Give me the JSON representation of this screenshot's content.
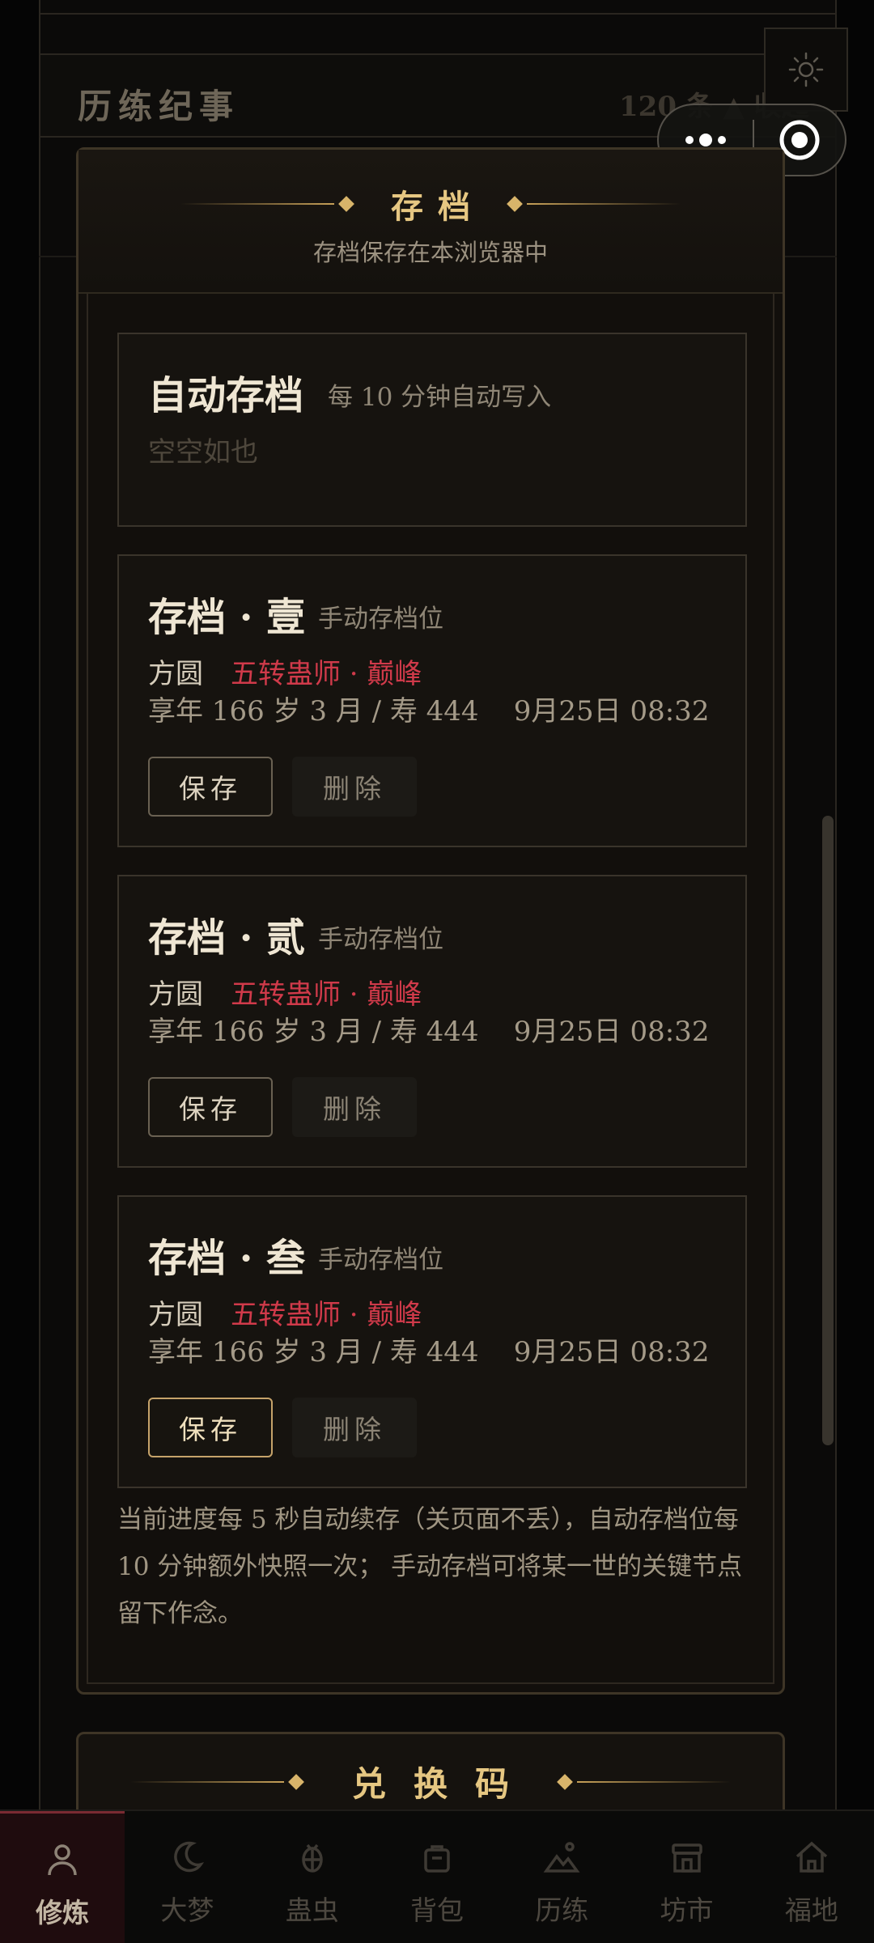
{
  "background": {
    "section_title": "历练纪事",
    "count_text": "120 条 ▲ 收起"
  },
  "modal": {
    "title": "存档",
    "subtitle": "存档保存在本浏览器中",
    "auto_slot": {
      "title": "自动存档",
      "tag": "每 10 分钟自动写入",
      "empty_text": "空空如也"
    },
    "slots": [
      {
        "title": "存档 · 壹",
        "tag": "手动存档位",
        "name": "方圆",
        "realm": "五转蛊师 · 巅峰",
        "age": "享年 166 岁 3 月 / 寿 444    9月25日 08:32",
        "save_label": "保存",
        "delete_label": "删除"
      },
      {
        "title": "存档 · 贰",
        "tag": "手动存档位",
        "name": "方圆",
        "realm": "五转蛊师 · 巅峰",
        "age": "享年 166 岁 3 月 / 寿 444    9月25日 08:32",
        "save_label": "保存",
        "delete_label": "删除"
      },
      {
        "title": "存档 · 叁",
        "tag": "手动存档位",
        "name": "方圆",
        "realm": "五转蛊师 · 巅峰",
        "age": "享年 166 岁 3 月 / 寿 444    9月25日 08:32",
        "save_label": "保存",
        "delete_label": "删除"
      }
    ],
    "note": "当前进度每 5 秒自动续存（关页面不丢），自动存档位每 10 分钟额外快照一次； 手动存档可将某一世的关键节点留下作念。"
  },
  "next_modal": {
    "title": "兑换码"
  },
  "tabs": [
    {
      "label": "修炼",
      "icon": "person-icon",
      "active": true
    },
    {
      "label": "大梦",
      "icon": "moon-icon",
      "active": false
    },
    {
      "label": "蛊虫",
      "icon": "bug-icon",
      "active": false
    },
    {
      "label": "背包",
      "icon": "bag-icon",
      "active": false
    },
    {
      "label": "历练",
      "icon": "mountain-icon",
      "active": false
    },
    {
      "label": "坊市",
      "icon": "shop-icon",
      "active": false
    },
    {
      "label": "福地",
      "icon": "home-icon",
      "active": false
    }
  ],
  "colors": {
    "accent_gold": "#e6c782",
    "realm_red": "#d03a4a",
    "active_tab_bg": "#1f0c0e"
  }
}
